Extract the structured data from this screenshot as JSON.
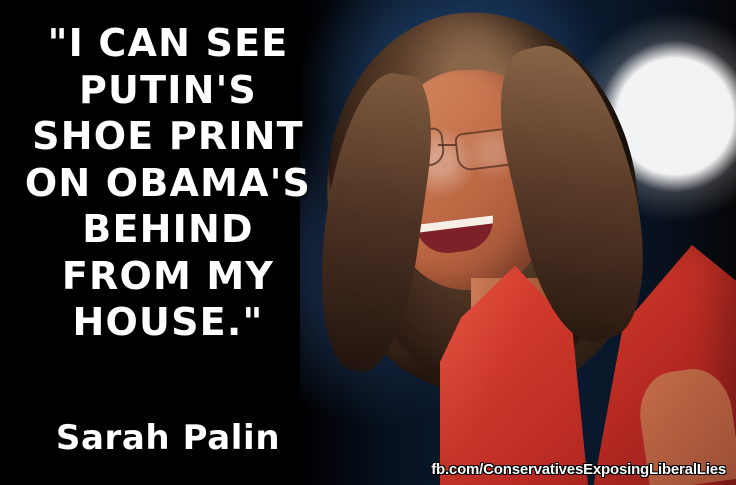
{
  "meme": {
    "quote_lines": [
      "\"I CAN SEE",
      "PUTIN'S",
      "SHOE PRINT",
      "ON OBAMA'S",
      "BEHIND",
      "FROM MY",
      "HOUSE.\""
    ],
    "attribution": "Sarah Palin",
    "watermark": "fb.com/ConservativesExposingLiberalLies"
  },
  "colors": {
    "background": "#000000",
    "text": "#ffffff",
    "cardigan": "#d8392c",
    "skin": "#c97b56",
    "hair": "#5e412c"
  }
}
